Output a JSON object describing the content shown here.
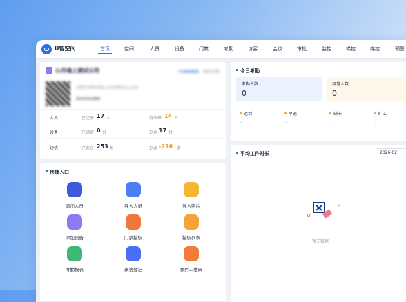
{
  "header": {
    "brand": "U智空间",
    "nav": [
      "首页",
      "空间",
      "人员",
      "设备",
      "门禁",
      "考勤",
      "访客",
      "会议",
      "审批",
      "监控",
      "梯控",
      "梯控",
      "预警"
    ]
  },
  "company": {
    "name": "心月魂上测试公司",
    "tag": "升级旗舰版",
    "switch": "组织切换",
    "desc": "U智空间移动端·企业码登记入企业",
    "code": "DUVGUUBN",
    "rows": [
      {
        "label": "人员",
        "k1": "已注册",
        "v1": "17",
        "u1": "人",
        "k2": "待审核",
        "v2": "14",
        "u2": "人"
      },
      {
        "label": "设备",
        "k1": "已绑定",
        "v1": "0",
        "u1": "台",
        "k2": "剩余",
        "v2": "17",
        "u2": "台"
      },
      {
        "label": "短信",
        "k1": "已发送",
        "v1": "253",
        "u1": "条",
        "k2": "剩余",
        "v2": "-236",
        "u2": "条"
      }
    ]
  },
  "quick": {
    "title": "快捷入口",
    "items": [
      {
        "label": "添加人员",
        "icon": "add-user-icon",
        "color": "#3b5bdb"
      },
      {
        "label": "导入人员",
        "icon": "import-user-icon",
        "color": "#4c7ef3"
      },
      {
        "label": "导入照片",
        "icon": "photo-icon",
        "color": "#f5b731"
      },
      {
        "label": "添加设备",
        "icon": "device-icon",
        "color": "#8a7cf0"
      },
      {
        "label": "门禁授权",
        "icon": "door-icon",
        "color": "#f0773b"
      },
      {
        "label": "授权列表",
        "icon": "shield-icon",
        "color": "#f5a33b"
      },
      {
        "label": "考勤报表",
        "icon": "calendar-icon",
        "color": "#3fb876"
      },
      {
        "label": "来访登记",
        "icon": "visitor-icon",
        "color": "#4c6ef3"
      },
      {
        "label": "预约二维码",
        "icon": "qrcode-icon",
        "color": "#f07c3b"
      }
    ]
  },
  "attendance": {
    "title": "今日考勤",
    "boxes": [
      {
        "label": "考勤人数",
        "value": "0"
      },
      {
        "label": "异常人数",
        "value": "0"
      }
    ],
    "stats": [
      {
        "label": "迟到",
        "value": "-"
      },
      {
        "label": "早退",
        "value": "-"
      },
      {
        "label": "缺卡",
        "value": "-"
      },
      {
        "label": "旷工",
        "value": "-"
      }
    ]
  },
  "worktime": {
    "title": "平均工作时长",
    "date": "2026-02",
    "empty": "暂无数据"
  }
}
